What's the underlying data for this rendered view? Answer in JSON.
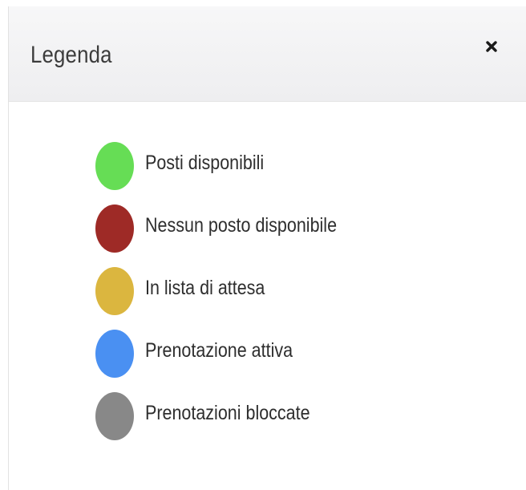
{
  "modal": {
    "title": "Legenda",
    "close_icon": "close-icon"
  },
  "legend": {
    "items": [
      {
        "label": "Posti disponibili",
        "color": "#66dd55"
      },
      {
        "label": "Nessun posto disponibile",
        "color": "#9e2a26"
      },
      {
        "label": "In lista di attesa",
        "color": "#dbb63f"
      },
      {
        "label": "Prenotazione attiva",
        "color": "#4a90f2"
      },
      {
        "label": "Prenotazioni bloccate",
        "color": "#888888"
      }
    ]
  }
}
